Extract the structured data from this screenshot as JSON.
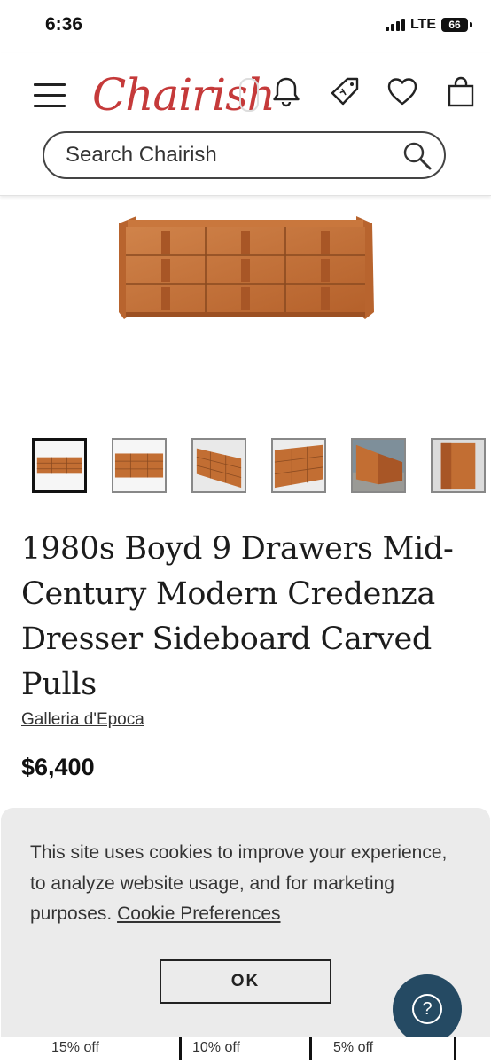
{
  "status_bar": {
    "time": "6:36",
    "network": "LTE",
    "battery": "66"
  },
  "header": {
    "logo_text": "Chairish",
    "search": {
      "placeholder": "Search Chairish",
      "value": ""
    }
  },
  "product": {
    "title": "1980s Boyd 9 Drawers Mid-Century Modern Credenza Dresser Sideboard Carved Pulls",
    "dealer": "Galleria d'Epoca",
    "price": "$6,400",
    "thumbnail_count": 6,
    "selected_thumbnail": 1
  },
  "cookie_banner": {
    "message": "This site uses cookies to improve your experience, to analyze website usage, and for marketing purposes.",
    "link_label": "Cookie Preferences",
    "ok_label": "OK"
  },
  "discount_tiers": [
    "15% off",
    "10% off",
    "5% off"
  ],
  "icons": {
    "menu": "hamburger-menu-icon",
    "notifications": "bell-icon",
    "offers": "price-tag-icon",
    "favorites": "heart-icon",
    "cart": "shopping-bag-icon",
    "search": "magnifier-icon",
    "help": "question-mark-icon"
  },
  "colors": {
    "brand": "#c53a3a",
    "help_button": "#254a63",
    "banner_bg": "#ebebeb",
    "wood": "#c26e33"
  }
}
